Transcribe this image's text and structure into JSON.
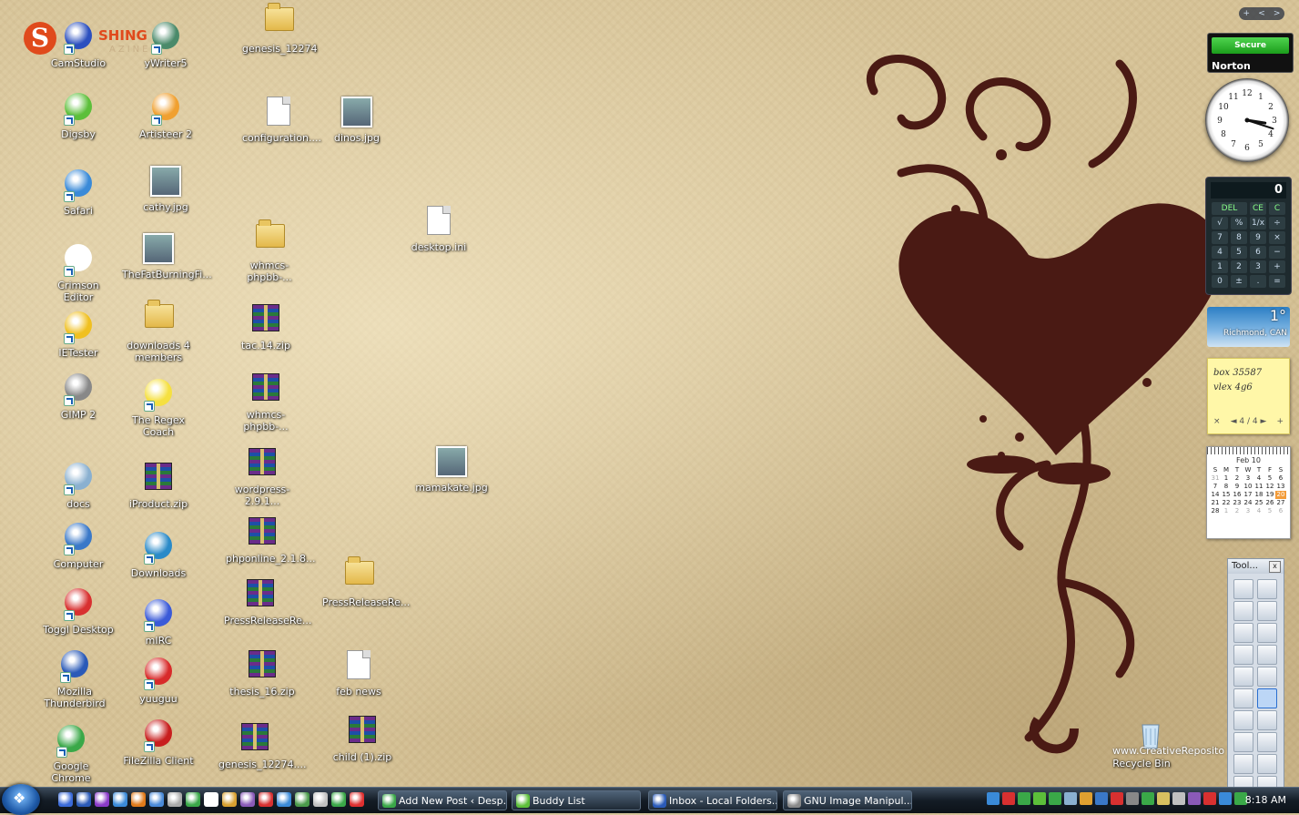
{
  "desktop": {
    "icons": [
      {
        "label": "CamStudio",
        "kind": "app",
        "color": "#2b4fbf"
      },
      {
        "label": "yWriter5",
        "kind": "app",
        "color": "#4a8a6a"
      },
      {
        "label": "genesis_12274",
        "kind": "folder"
      },
      {
        "label": "Digsby",
        "kind": "app",
        "color": "#5cbf3a"
      },
      {
        "label": "Artisteer 2",
        "kind": "app",
        "color": "#f0a030"
      },
      {
        "label": "configuration....",
        "kind": "doc"
      },
      {
        "label": "dinos.jpg",
        "kind": "photo"
      },
      {
        "label": "Safari",
        "kind": "app",
        "color": "#3a8ad8"
      },
      {
        "label": "cathy.jpg",
        "kind": "photo"
      },
      {
        "label": "desktop.ini",
        "kind": "doc"
      },
      {
        "label": "Crimson Editor",
        "kind": "app",
        "color": "#ffffff"
      },
      {
        "label": "TheFatBurningFi...",
        "kind": "photo"
      },
      {
        "label": "whmcs-phpbb-...",
        "kind": "folder"
      },
      {
        "label": "IETester",
        "kind": "app",
        "color": "#f0c020"
      },
      {
        "label": "downloads 4 members",
        "kind": "folder"
      },
      {
        "label": "tac.14.zip",
        "kind": "zip"
      },
      {
        "label": "GIMP 2",
        "kind": "app",
        "color": "#888888"
      },
      {
        "label": "The Regex Coach",
        "kind": "app",
        "color": "#f5e040"
      },
      {
        "label": "whmcs-phpbb-...",
        "kind": "zip"
      },
      {
        "label": "docs",
        "kind": "app",
        "color": "#8ab0d0"
      },
      {
        "label": "iProduct.zip",
        "kind": "zip"
      },
      {
        "label": "wordpress-2.9.1...",
        "kind": "zip"
      },
      {
        "label": "mamakate.jpg",
        "kind": "photo"
      },
      {
        "label": "Computer",
        "kind": "app",
        "color": "#3a78c8"
      },
      {
        "label": "Downloads",
        "kind": "app",
        "color": "#2a8ac8"
      },
      {
        "label": "phponline_2.1.8...",
        "kind": "zip"
      },
      {
        "label": "PressReleaseRe...",
        "kind": "folder"
      },
      {
        "label": "Toggl Desktop",
        "kind": "app",
        "color": "#d83030"
      },
      {
        "label": "mIRC",
        "kind": "app",
        "color": "#3a5ad8"
      },
      {
        "label": "PressReleaseRe...",
        "kind": "zip"
      },
      {
        "label": "Mozilla Thunderbird",
        "kind": "app",
        "color": "#2a5ab8"
      },
      {
        "label": "yuuguu",
        "kind": "app",
        "color": "#d82a2a"
      },
      {
        "label": "thesis_16.zip",
        "kind": "zip"
      },
      {
        "label": "feb news",
        "kind": "doc"
      },
      {
        "label": "Google Chrome",
        "kind": "app",
        "color": "#3aa848"
      },
      {
        "label": "FileZilla Client",
        "kind": "app",
        "color": "#c81e1e"
      },
      {
        "label": "genesis_12274....",
        "kind": "zip"
      },
      {
        "label": "child (1).zip",
        "kind": "zip"
      }
    ],
    "magazine_logo": {
      "letter": "S",
      "text": "SHING",
      "sub": "AZINE"
    },
    "recycle_bin": {
      "label": "Recycle Bin"
    },
    "watermark": "www.CreativeReposito"
  },
  "gadgets": {
    "controls": [
      "+",
      "<",
      ">"
    ],
    "norton": {
      "status": "Secure",
      "brand": "Norton"
    },
    "clock": {
      "hour": 3,
      "minute": 18,
      "numbers": [
        "12",
        "1",
        "2",
        "3",
        "4",
        "5",
        "6",
        "7",
        "8",
        "9",
        "10",
        "11"
      ]
    },
    "calculator": {
      "display": "0",
      "keys": [
        "DEL",
        "CE",
        "C",
        "√",
        "%",
        "1/x",
        "÷",
        "7",
        "8",
        "9",
        "×",
        "4",
        "5",
        "6",
        "−",
        "1",
        "2",
        "3",
        "+",
        "0",
        "±",
        ".",
        "="
      ]
    },
    "weather": {
      "temp": "1°",
      "location": "Richmond, CAN"
    },
    "notes": {
      "lines": [
        "box 35587",
        "vlex 4g6"
      ],
      "pager": "4 / 4",
      "close": "×",
      "prev": "◄",
      "next": "►",
      "add": "+"
    },
    "calendar": {
      "month": "Feb 10",
      "weekdays": [
        "S",
        "M",
        "T",
        "W",
        "T",
        "F",
        "S"
      ],
      "days": [
        {
          "d": "31",
          "dim": true
        },
        {
          "d": "1"
        },
        {
          "d": "2"
        },
        {
          "d": "3"
        },
        {
          "d": "4"
        },
        {
          "d": "5"
        },
        {
          "d": "6"
        },
        {
          "d": "7"
        },
        {
          "d": "8"
        },
        {
          "d": "9"
        },
        {
          "d": "10"
        },
        {
          "d": "11"
        },
        {
          "d": "12"
        },
        {
          "d": "13"
        },
        {
          "d": "14"
        },
        {
          "d": "15"
        },
        {
          "d": "16"
        },
        {
          "d": "17"
        },
        {
          "d": "18"
        },
        {
          "d": "19"
        },
        {
          "d": "20",
          "today": true
        },
        {
          "d": "21"
        },
        {
          "d": "22"
        },
        {
          "d": "23"
        },
        {
          "d": "24"
        },
        {
          "d": "25"
        },
        {
          "d": "26"
        },
        {
          "d": "27"
        },
        {
          "d": "28"
        },
        {
          "d": "1",
          "dim": true
        },
        {
          "d": "2",
          "dim": true
        },
        {
          "d": "3",
          "dim": true
        },
        {
          "d": "4",
          "dim": true
        },
        {
          "d": "5",
          "dim": true
        },
        {
          "d": "6",
          "dim": true
        }
      ]
    },
    "toolbox": {
      "title": "Tool...",
      "close": "x",
      "tool_count": 20,
      "selected_index": 11
    }
  },
  "taskbar": {
    "quicklaunch_colors": [
      "#3a6ad8",
      "#2a5ab8",
      "#8a3ac8",
      "#3a8ad8",
      "#e07a1a",
      "#4a8ad8",
      "#aaaaaa",
      "#3aa848",
      "#ffffff",
      "#d8a030",
      "#8a5ab8",
      "#d83030",
      "#3a8ad8",
      "#4a9a4a",
      "#c0c0c0",
      "#3aa848",
      "#e03030"
    ],
    "tasks": [
      {
        "label": "Add New Post ‹ Desp...",
        "color": "#3aa848"
      },
      {
        "label": "Buddy List",
        "color": "#5cbf3a"
      },
      {
        "label": "Inbox - Local Folders...",
        "color": "#2a5ab8"
      },
      {
        "label": "GNU Image Manipul...",
        "color": "#888888"
      }
    ],
    "tray_colors": [
      "#3a8ad8",
      "#d83030",
      "#3aa848",
      "#5cbf3a",
      "#3aa848",
      "#8ab0d0",
      "#e0a030",
      "#3a78c8",
      "#d83030",
      "#888888",
      "#3aa848",
      "#d8c060",
      "#c0c0c0",
      "#8a5ab8",
      "#d83030",
      "#3a8ad8",
      "#3aa848"
    ],
    "time": "8:18 AM"
  }
}
